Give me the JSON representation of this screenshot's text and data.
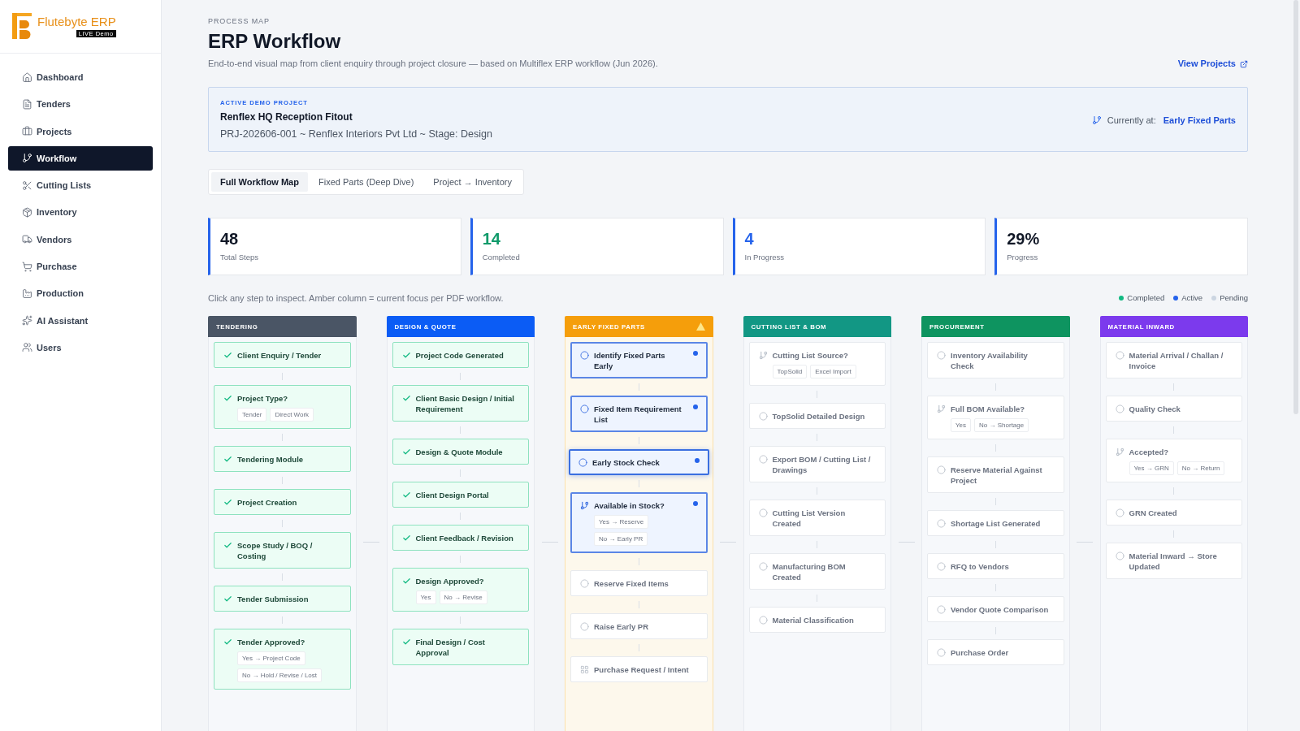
{
  "sidebar": {
    "logo": {
      "name": "Flutebyte ERP",
      "badge": "LIVE Demo"
    },
    "items": [
      {
        "label": "Dashboard",
        "selected": false
      },
      {
        "label": "Tenders",
        "selected": false
      },
      {
        "label": "Projects",
        "selected": false
      },
      {
        "label": "Workflow",
        "selected": true
      },
      {
        "label": "Cutting Lists",
        "selected": false
      },
      {
        "label": "Inventory",
        "selected": false
      },
      {
        "label": "Vendors",
        "selected": false
      },
      {
        "label": "Purchase",
        "selected": false
      },
      {
        "label": "Production",
        "selected": false
      },
      {
        "label": "AI Assistant",
        "selected": false
      },
      {
        "label": "Users",
        "selected": false
      }
    ]
  },
  "header": {
    "eyebrow": "PROCESS MAP",
    "title": "ERP Workflow",
    "subtitle": "End-to-end visual map from client enquiry through project closure — based on Multiflex ERP workflow (Jun 2026).",
    "link": "View Projects"
  },
  "project": {
    "eyebrow": "ACTIVE DEMO PROJECT",
    "name": "Renflex HQ Reception Fitout",
    "details": "PRJ-202606-001 ~ Renflex Interiors Pvt Ltd ~ Stage: Design",
    "current_label": "Currently at:",
    "current_value": "Early Fixed Parts"
  },
  "tabs": [
    {
      "label": "Full Workflow Map",
      "selected": true
    },
    {
      "label": "Fixed Parts (Deep Dive)",
      "selected": false
    },
    {
      "label": "Project → Inventory",
      "selected": false
    }
  ],
  "stats": [
    {
      "value": "48",
      "label": "Total Steps",
      "color": "#111827"
    },
    {
      "value": "14",
      "label": "Completed",
      "color": "#0f9a6a"
    },
    {
      "value": "4",
      "label": "In Progress",
      "color": "#2563eb"
    },
    {
      "value": "29%",
      "label": "Progress",
      "color": "#111827"
    }
  ],
  "hint": "Click any step to inspect. Amber column = current focus per PDF workflow.",
  "legend": [
    {
      "label": "Completed",
      "color": "#10b981"
    },
    {
      "label": "Active",
      "color": "#2563eb"
    },
    {
      "label": "Pending",
      "color": "#cbd5e1"
    }
  ],
  "columns": [
    {
      "title": "TENDERING",
      "color": "#4a5565",
      "focus": false,
      "steps": [
        {
          "label": "Client Enquiry / Tender",
          "kind": "task",
          "completed": true,
          "active": false,
          "selected": false
        },
        {
          "label": "Project Type?",
          "kind": "decision",
          "completed": true,
          "active": false,
          "selected": false,
          "options": [
            "Tender",
            "Direct Work"
          ]
        },
        {
          "label": "Tendering Module",
          "kind": "task",
          "completed": true,
          "active": false,
          "selected": false
        },
        {
          "label": "Project Creation",
          "kind": "task",
          "completed": true,
          "active": false,
          "selected": false
        },
        {
          "label": "Scope Study / BOQ / Costing",
          "kind": "task",
          "completed": true,
          "active": false,
          "selected": false
        },
        {
          "label": "Tender Submission",
          "kind": "task",
          "completed": true,
          "active": false,
          "selected": false
        },
        {
          "label": "Tender Approved?",
          "kind": "decision",
          "completed": true,
          "active": false,
          "selected": false,
          "options": [
            "Yes → Project Code",
            "No → Hold / Revise / Lost"
          ]
        }
      ]
    },
    {
      "title": "DESIGN & QUOTE",
      "color": "#0b5cf5",
      "focus": false,
      "steps": [
        {
          "label": "Project Code Generated",
          "kind": "task",
          "completed": true,
          "active": false,
          "selected": false
        },
        {
          "label": "Client Basic Design / Initial Requirement",
          "kind": "task",
          "completed": true,
          "active": false,
          "selected": false
        },
        {
          "label": "Design & Quote Module",
          "kind": "task",
          "completed": true,
          "active": false,
          "selected": false
        },
        {
          "label": "Client Design Portal",
          "kind": "task",
          "completed": true,
          "active": false,
          "selected": false
        },
        {
          "label": "Client Feedback / Revision",
          "kind": "task",
          "completed": true,
          "active": false,
          "selected": false
        },
        {
          "label": "Design Approved?",
          "kind": "decision",
          "completed": true,
          "active": false,
          "selected": false,
          "options": [
            "Yes",
            "No → Revise"
          ]
        },
        {
          "label": "Final Design / Cost Approval",
          "kind": "task",
          "completed": true,
          "active": false,
          "selected": false
        }
      ]
    },
    {
      "title": "EARLY FIXED PARTS",
      "color": "#f59e0b",
      "focus": true,
      "steps": [
        {
          "label": "Identify Fixed Parts Early",
          "kind": "task",
          "completed": false,
          "active": true,
          "selected": false
        },
        {
          "label": "Fixed Item Requirement List",
          "kind": "task",
          "completed": false,
          "active": true,
          "selected": false
        },
        {
          "label": "Early Stock Check",
          "kind": "task",
          "completed": false,
          "active": true,
          "selected": true
        },
        {
          "label": "Available in Stock?",
          "kind": "decision",
          "completed": false,
          "active": true,
          "selected": false,
          "options": [
            "Yes → Reserve",
            "No → Early PR"
          ]
        },
        {
          "label": "Reserve Fixed Items",
          "kind": "task",
          "completed": false,
          "active": false,
          "selected": false
        },
        {
          "label": "Raise Early PR",
          "kind": "task",
          "completed": false,
          "active": false,
          "selected": false
        },
        {
          "label": "Purchase Request / Intent",
          "kind": "module",
          "completed": false,
          "active": false,
          "selected": false
        }
      ]
    },
    {
      "title": "CUTTING LIST & BOM",
      "color": "#129784",
      "focus": false,
      "steps": [
        {
          "label": "Cutting List Source?",
          "kind": "decision",
          "completed": false,
          "active": false,
          "selected": false,
          "options": [
            "TopSolid",
            "Excel Import"
          ]
        },
        {
          "label": "TopSolid Detailed Design",
          "kind": "task",
          "completed": false,
          "active": false,
          "selected": false
        },
        {
          "label": "Export BOM / Cutting List / Drawings",
          "kind": "task",
          "completed": false,
          "active": false,
          "selected": false
        },
        {
          "label": "Cutting List Version Created",
          "kind": "task",
          "completed": false,
          "active": false,
          "selected": false
        },
        {
          "label": "Manufacturing BOM Created",
          "kind": "task",
          "completed": false,
          "active": false,
          "selected": false
        },
        {
          "label": "Material Classification",
          "kind": "task",
          "completed": false,
          "active": false,
          "selected": false
        }
      ]
    },
    {
      "title": "PROCUREMENT",
      "color": "#0e9460",
      "focus": false,
      "steps": [
        {
          "label": "Inventory Availability Check",
          "kind": "task",
          "completed": false,
          "active": false,
          "selected": false
        },
        {
          "label": "Full BOM Available?",
          "kind": "decision",
          "completed": false,
          "active": false,
          "selected": false,
          "options": [
            "Yes",
            "No → Shortage"
          ]
        },
        {
          "label": "Reserve Material Against Project",
          "kind": "task",
          "completed": false,
          "active": false,
          "selected": false
        },
        {
          "label": "Shortage List Generated",
          "kind": "task",
          "completed": false,
          "active": false,
          "selected": false
        },
        {
          "label": "RFQ to Vendors",
          "kind": "task",
          "completed": false,
          "active": false,
          "selected": false
        },
        {
          "label": "Vendor Quote Comparison",
          "kind": "task",
          "completed": false,
          "active": false,
          "selected": false
        },
        {
          "label": "Purchase Order",
          "kind": "task",
          "completed": false,
          "active": false,
          "selected": false
        }
      ]
    },
    {
      "title": "MATERIAL INWARD",
      "color": "#7c3aed",
      "focus": false,
      "steps": [
        {
          "label": "Material Arrival / Challan / Invoice",
          "kind": "task",
          "completed": false,
          "active": false,
          "selected": false
        },
        {
          "label": "Quality Check",
          "kind": "task",
          "completed": false,
          "active": false,
          "selected": false
        },
        {
          "label": "Accepted?",
          "kind": "decision",
          "completed": false,
          "active": false,
          "selected": false,
          "options": [
            "Yes → GRN",
            "No → Return"
          ]
        },
        {
          "label": "GRN Created",
          "kind": "task",
          "completed": false,
          "active": false,
          "selected": false
        },
        {
          "label": "Material Inward → Store Updated",
          "kind": "task",
          "completed": false,
          "active": false,
          "selected": false
        }
      ]
    }
  ]
}
